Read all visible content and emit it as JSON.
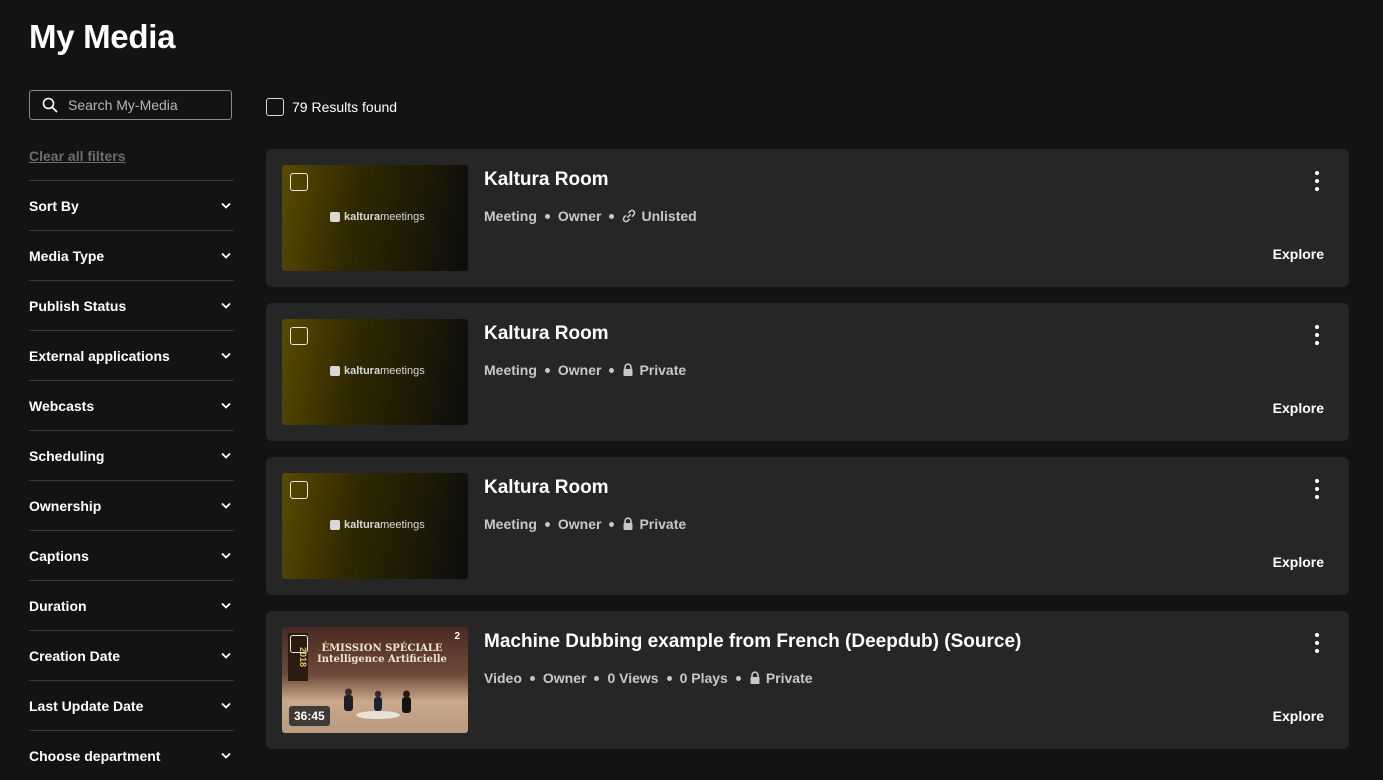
{
  "page": {
    "title": "My Media"
  },
  "search": {
    "placeholder": "Search My-Media"
  },
  "sidebar": {
    "clear_filters": "Clear all filters",
    "filters": [
      {
        "label": "Sort By"
      },
      {
        "label": "Media Type"
      },
      {
        "label": "Publish Status"
      },
      {
        "label": "External applications"
      },
      {
        "label": "Webcasts"
      },
      {
        "label": "Scheduling"
      },
      {
        "label": "Ownership"
      },
      {
        "label": "Captions"
      },
      {
        "label": "Duration"
      },
      {
        "label": "Creation Date"
      },
      {
        "label": "Last Update Date"
      },
      {
        "label": "Choose department"
      }
    ]
  },
  "results": {
    "count_text": "79 Results found"
  },
  "media": [
    {
      "title": "Kaltura Room",
      "type": "Meeting",
      "role": "Owner",
      "visibility": "Unlisted",
      "visibility_icon": "link-icon",
      "thumb_logo_bold": "kaltura",
      "thumb_logo_rest": "meetings",
      "explore_label": "Explore"
    },
    {
      "title": "Kaltura Room",
      "type": "Meeting",
      "role": "Owner",
      "visibility": "Private",
      "visibility_icon": "lock-icon",
      "thumb_logo_bold": "kaltura",
      "thumb_logo_rest": "meetings",
      "explore_label": "Explore"
    },
    {
      "title": "Kaltura Room",
      "type": "Meeting",
      "role": "Owner",
      "visibility": "Private",
      "visibility_icon": "lock-icon",
      "thumb_logo_bold": "kaltura",
      "thumb_logo_rest": "meetings",
      "explore_label": "Explore"
    },
    {
      "title": "Machine Dubbing example from French (Deepdub) (Source)",
      "type": "Video",
      "role": "Owner",
      "views": "0 Views",
      "plays": "0 Plays",
      "visibility": "Private",
      "visibility_icon": "lock-icon",
      "duration": "36:45",
      "thumb_banner_line1": "ÉMISSION SPÉCIALE",
      "thumb_banner_line2": "Intelligence Artificielle",
      "thumb_year": "2018",
      "thumb_count": "2",
      "explore_label": "Explore"
    }
  ],
  "colors": {
    "background": "#131313",
    "card": "#262626",
    "text": "#ffffff",
    "muted": "#c8c8c8"
  }
}
